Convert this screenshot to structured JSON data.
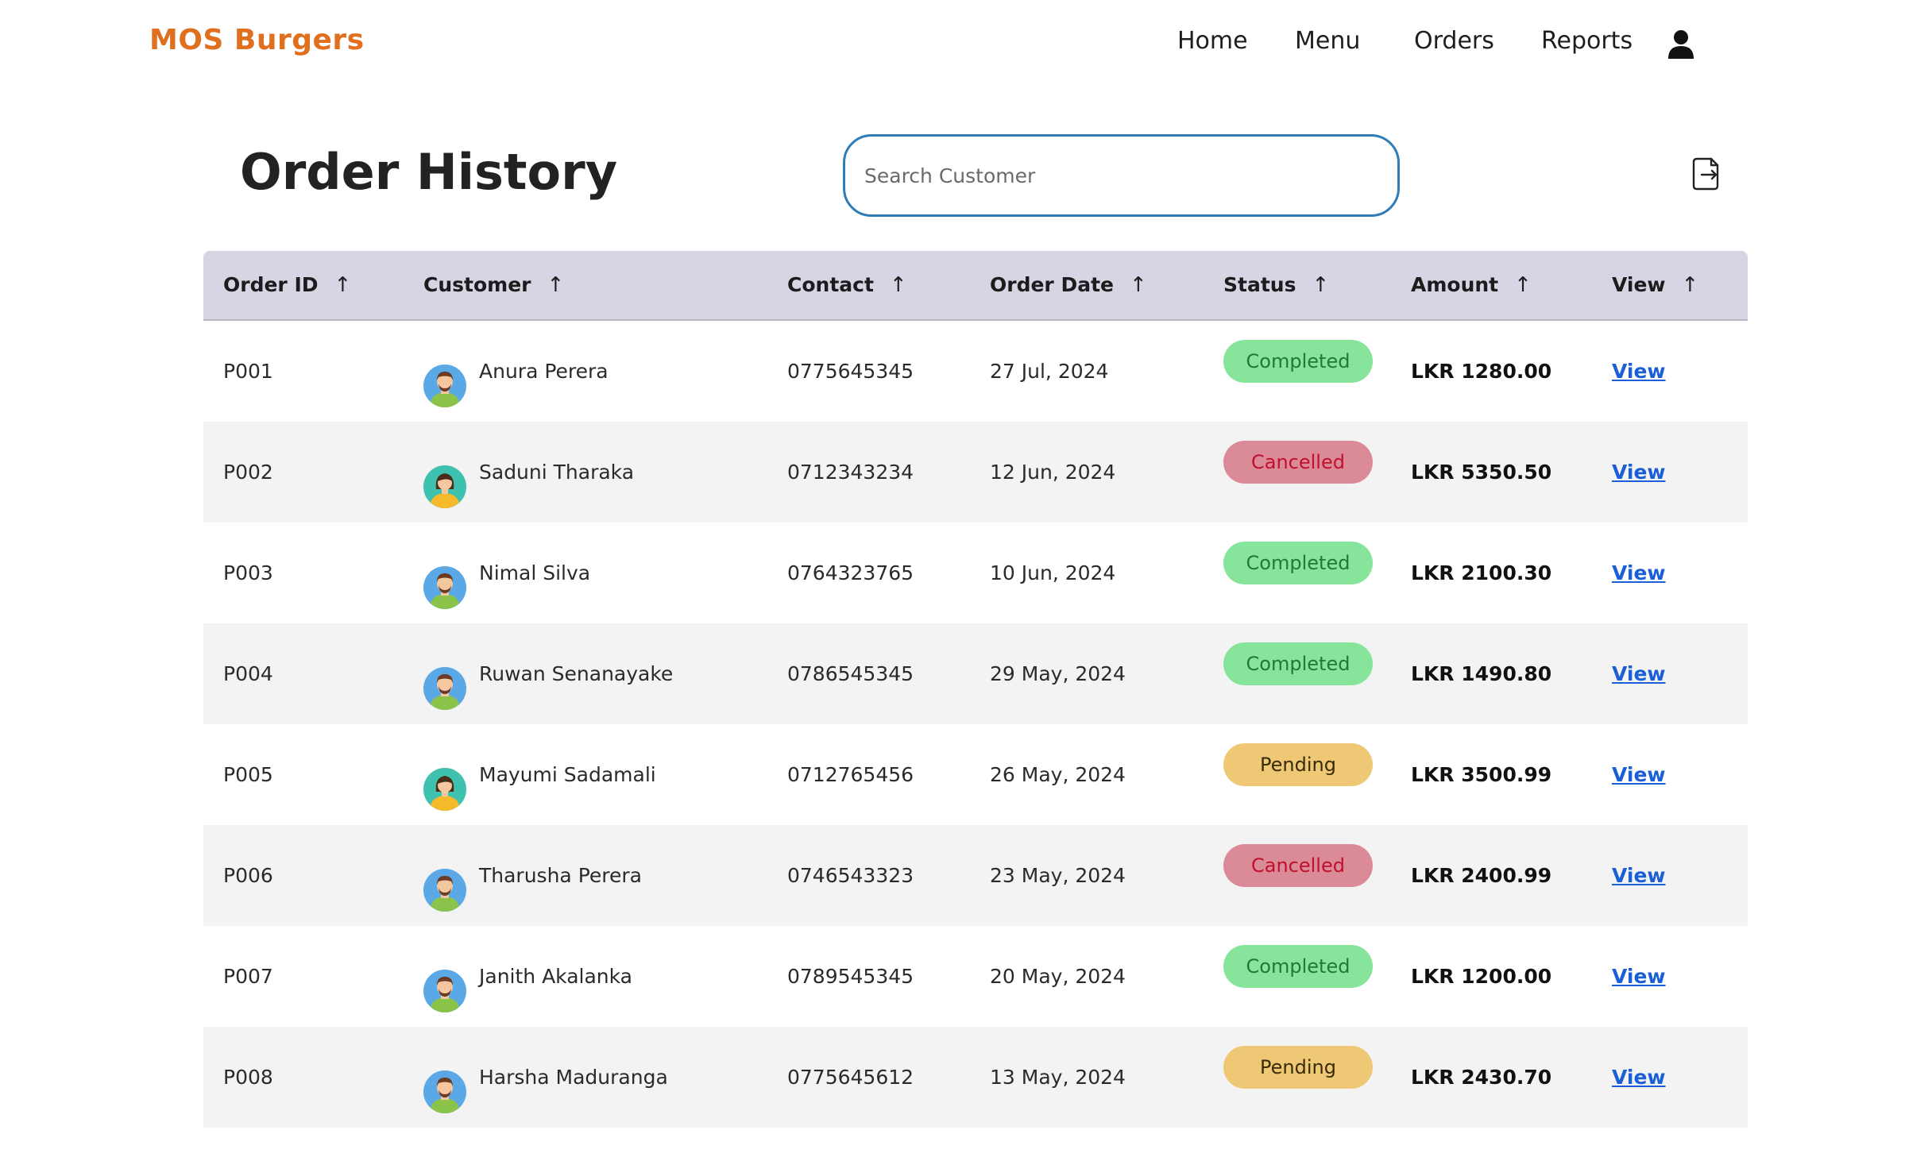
{
  "brand": {
    "name": "MOS Burgers",
    "color": "#e0701f"
  },
  "nav": {
    "items": [
      {
        "label": "Home"
      },
      {
        "label": "Menu"
      },
      {
        "label": "Orders"
      },
      {
        "label": "Reports"
      }
    ],
    "user_icon": "user-icon"
  },
  "page": {
    "title": "Order History",
    "search_placeholder": "Search Customer",
    "export_icon": "export-icon"
  },
  "table": {
    "columns": [
      {
        "label": "Order ID",
        "sort": "↑"
      },
      {
        "label": "Customer",
        "sort": "↑"
      },
      {
        "label": "Contact",
        "sort": "↑"
      },
      {
        "label": "Order Date",
        "sort": "↑"
      },
      {
        "label": "Status",
        "sort": "↑"
      },
      {
        "label": "Amount",
        "sort": "↑"
      },
      {
        "label": "View",
        "sort": "↑"
      }
    ],
    "rows": [
      {
        "id": "P001",
        "customer": "Anura Perera",
        "avatar": "male-avatar-icon",
        "contact": "0775645345",
        "date": "27 Jul, 2024",
        "status": "Completed",
        "amount": "LKR 1280.00",
        "view": "View"
      },
      {
        "id": "P002",
        "customer": "Saduni Tharaka",
        "avatar": "female-avatar-icon",
        "contact": "0712343234",
        "date": "12 Jun, 2024",
        "status": "Cancelled",
        "amount": "LKR 5350.50",
        "view": "View"
      },
      {
        "id": "P003",
        "customer": "Nimal Silva",
        "avatar": "male-avatar-icon",
        "contact": "0764323765",
        "date": "10 Jun, 2024",
        "status": "Completed",
        "amount": "LKR 2100.30",
        "view": "View"
      },
      {
        "id": "P004",
        "customer": "Ruwan Senanayake",
        "avatar": "male-avatar-icon",
        "contact": "0786545345",
        "date": "29 May, 2024",
        "status": "Completed",
        "amount": "LKR 1490.80",
        "view": "View"
      },
      {
        "id": "P005",
        "customer": "Mayumi Sadamali",
        "avatar": "female-avatar-icon",
        "contact": "0712765456",
        "date": "26 May, 2024",
        "status": "Pending",
        "amount": "LKR 3500.99",
        "view": "View"
      },
      {
        "id": "P006",
        "customer": "Tharusha Perera",
        "avatar": "male-avatar-icon",
        "contact": "0746543323",
        "date": "23 May, 2024",
        "status": "Cancelled",
        "amount": "LKR 2400.99",
        "view": "View"
      },
      {
        "id": "P007",
        "customer": "Janith Akalanka",
        "avatar": "male-avatar-icon",
        "contact": "0789545345",
        "date": "20 May, 2024",
        "status": "Completed",
        "amount": "LKR 1200.00",
        "view": "View"
      },
      {
        "id": "P008",
        "customer": "Harsha Maduranga",
        "avatar": "male-avatar-icon",
        "contact": "0775645612",
        "date": "13 May, 2024",
        "status": "Pending",
        "amount": "LKR 2430.70",
        "view": "View"
      }
    ]
  },
  "status_colors": {
    "Completed": {
      "bg": "#86e59a",
      "fg": "#1f7a35"
    },
    "Cancelled": {
      "bg": "#db8a98",
      "fg": "#c0102e"
    },
    "Pending": {
      "bg": "#eec874",
      "fg": "#3a2b08"
    }
  }
}
